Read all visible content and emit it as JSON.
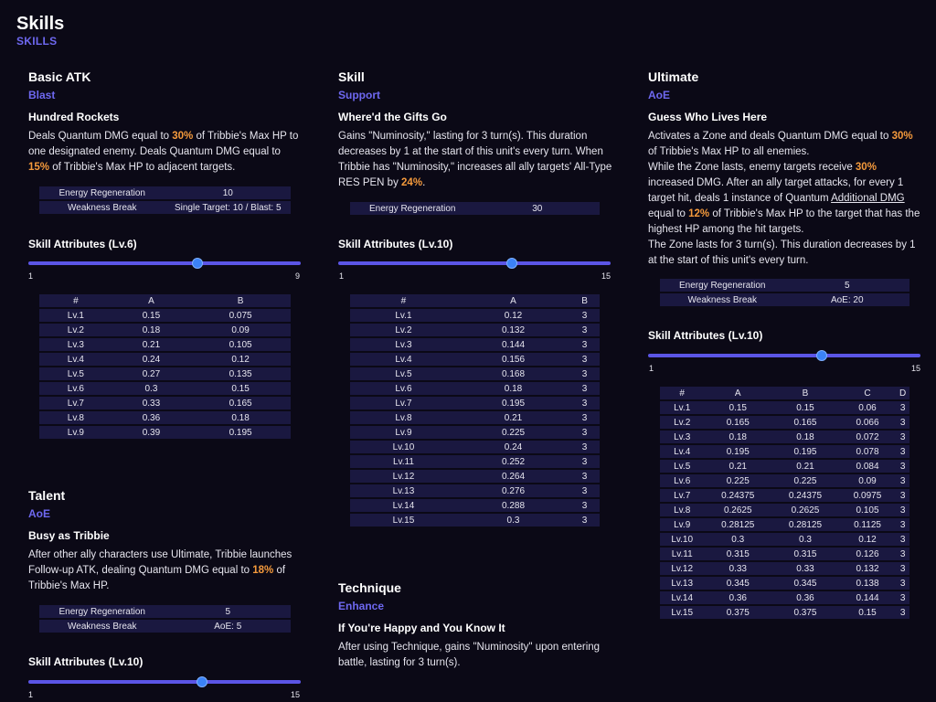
{
  "header": {
    "title": "Skills",
    "subtitle": "SKILLS"
  },
  "basic": {
    "title": "Basic ATK",
    "type": "Blast",
    "name": "Hundred Rockets",
    "desc": [
      {
        "t": "Deals Quantum DMG equal to "
      },
      {
        "t": "30%",
        "hl": true
      },
      {
        "t": " of Tribbie's Max HP to one designated enemy. Deals Quantum DMG equal to "
      },
      {
        "t": "15%",
        "hl": true
      },
      {
        "t": " of Tribbie's Max HP to adjacent targets."
      }
    ],
    "info": [
      [
        "Energy Regeneration",
        "10"
      ],
      [
        "Weakness Break",
        "Single Target: 10 / Blast: 5"
      ]
    ],
    "attr_title": "Skill Attributes (Lv.6)",
    "slider": {
      "min": "1",
      "max": "9",
      "value": 6
    },
    "headers": [
      "#",
      "A",
      "B"
    ],
    "rows": [
      [
        "Lv.1",
        "0.15",
        "0.075"
      ],
      [
        "Lv.2",
        "0.18",
        "0.09"
      ],
      [
        "Lv.3",
        "0.21",
        "0.105"
      ],
      [
        "Lv.4",
        "0.24",
        "0.12"
      ],
      [
        "Lv.5",
        "0.27",
        "0.135"
      ],
      [
        "Lv.6",
        "0.3",
        "0.15"
      ],
      [
        "Lv.7",
        "0.33",
        "0.165"
      ],
      [
        "Lv.8",
        "0.36",
        "0.18"
      ],
      [
        "Lv.9",
        "0.39",
        "0.195"
      ]
    ]
  },
  "talent": {
    "title": "Talent",
    "type": "AoE",
    "name": "Busy as Tribbie",
    "desc": [
      {
        "t": "After other ally characters use Ultimate, Tribbie launches Follow-up ATK, dealing Quantum DMG equal to "
      },
      {
        "t": "18%",
        "hl": true
      },
      {
        "t": " of Tribbie's Max HP."
      }
    ],
    "info": [
      [
        "Energy Regeneration",
        "5"
      ],
      [
        "Weakness Break",
        "AoE: 5"
      ]
    ],
    "attr_title": "Skill Attributes (Lv.10)",
    "slider": {
      "min": "1",
      "max": "15",
      "value": 10
    }
  },
  "skill": {
    "title": "Skill",
    "type": "Support",
    "name": "Where'd the Gifts Go",
    "desc": [
      {
        "t": "Gains \"Numinosity,\" lasting for 3 turn(s). This duration decreases by 1 at the start of this unit's every turn. When Tribbie has \"Numinosity,\" increases all ally targets' All-Type RES PEN by "
      },
      {
        "t": "24%",
        "hl": true
      },
      {
        "t": "."
      }
    ],
    "info": [
      [
        "Energy Regeneration",
        "30"
      ]
    ],
    "attr_title": "Skill Attributes (Lv.10)",
    "slider": {
      "min": "1",
      "max": "15",
      "value": 10
    },
    "headers": [
      "#",
      "A",
      "B"
    ],
    "rows": [
      [
        "Lv.1",
        "0.12",
        "3"
      ],
      [
        "Lv.2",
        "0.132",
        "3"
      ],
      [
        "Lv.3",
        "0.144",
        "3"
      ],
      [
        "Lv.4",
        "0.156",
        "3"
      ],
      [
        "Lv.5",
        "0.168",
        "3"
      ],
      [
        "Lv.6",
        "0.18",
        "3"
      ],
      [
        "Lv.7",
        "0.195",
        "3"
      ],
      [
        "Lv.8",
        "0.21",
        "3"
      ],
      [
        "Lv.9",
        "0.225",
        "3"
      ],
      [
        "Lv.10",
        "0.24",
        "3"
      ],
      [
        "Lv.11",
        "0.252",
        "3"
      ],
      [
        "Lv.12",
        "0.264",
        "3"
      ],
      [
        "Lv.13",
        "0.276",
        "3"
      ],
      [
        "Lv.14",
        "0.288",
        "3"
      ],
      [
        "Lv.15",
        "0.3",
        "3"
      ]
    ]
  },
  "technique": {
    "title": "Technique",
    "type": "Enhance",
    "name": "If You're Happy and You Know It",
    "desc": [
      {
        "t": "After using Technique, gains \"Numinosity\" upon entering battle, lasting for 3 turn(s)."
      }
    ]
  },
  "ultimate": {
    "title": "Ultimate",
    "type": "AoE",
    "name": "Guess Who Lives Here",
    "desc": [
      {
        "t": "Activates a Zone and deals Quantum DMG equal to "
      },
      {
        "t": "30%",
        "hl": true
      },
      {
        "t": " of Tribbie's Max HP to all enemies."
      },
      {
        "br": true
      },
      {
        "t": "While the Zone lasts, enemy targets receive "
      },
      {
        "t": "30%",
        "hl": true
      },
      {
        "t": " increased DMG. After an ally target attacks, for every 1 target hit, deals 1 instance of Quantum "
      },
      {
        "t": "Additional DMG",
        "ul": true
      },
      {
        "t": " equal to "
      },
      {
        "t": "12%",
        "hl": true
      },
      {
        "t": " of Tribbie's Max HP to the target that has the highest HP among the hit targets."
      },
      {
        "br": true
      },
      {
        "t": "The Zone lasts for 3 turn(s). This duration decreases by 1 at the start of this unit's every turn."
      }
    ],
    "info": [
      [
        "Energy Regeneration",
        "5"
      ],
      [
        "Weakness Break",
        "AoE: 20"
      ]
    ],
    "attr_title": "Skill Attributes (Lv.10)",
    "slider": {
      "min": "1",
      "max": "15",
      "value": 10
    },
    "headers": [
      "#",
      "A",
      "B",
      "C",
      "D"
    ],
    "rows": [
      [
        "Lv.1",
        "0.15",
        "0.15",
        "0.06",
        "3"
      ],
      [
        "Lv.2",
        "0.165",
        "0.165",
        "0.066",
        "3"
      ],
      [
        "Lv.3",
        "0.18",
        "0.18",
        "0.072",
        "3"
      ],
      [
        "Lv.4",
        "0.195",
        "0.195",
        "0.078",
        "3"
      ],
      [
        "Lv.5",
        "0.21",
        "0.21",
        "0.084",
        "3"
      ],
      [
        "Lv.6",
        "0.225",
        "0.225",
        "0.09",
        "3"
      ],
      [
        "Lv.7",
        "0.24375",
        "0.24375",
        "0.0975",
        "3"
      ],
      [
        "Lv.8",
        "0.2625",
        "0.2625",
        "0.105",
        "3"
      ],
      [
        "Lv.9",
        "0.28125",
        "0.28125",
        "0.1125",
        "3"
      ],
      [
        "Lv.10",
        "0.3",
        "0.3",
        "0.12",
        "3"
      ],
      [
        "Lv.11",
        "0.315",
        "0.315",
        "0.126",
        "3"
      ],
      [
        "Lv.12",
        "0.33",
        "0.33",
        "0.132",
        "3"
      ],
      [
        "Lv.13",
        "0.345",
        "0.345",
        "0.138",
        "3"
      ],
      [
        "Lv.14",
        "0.36",
        "0.36",
        "0.144",
        "3"
      ],
      [
        "Lv.15",
        "0.375",
        "0.375",
        "0.15",
        "3"
      ]
    ]
  }
}
